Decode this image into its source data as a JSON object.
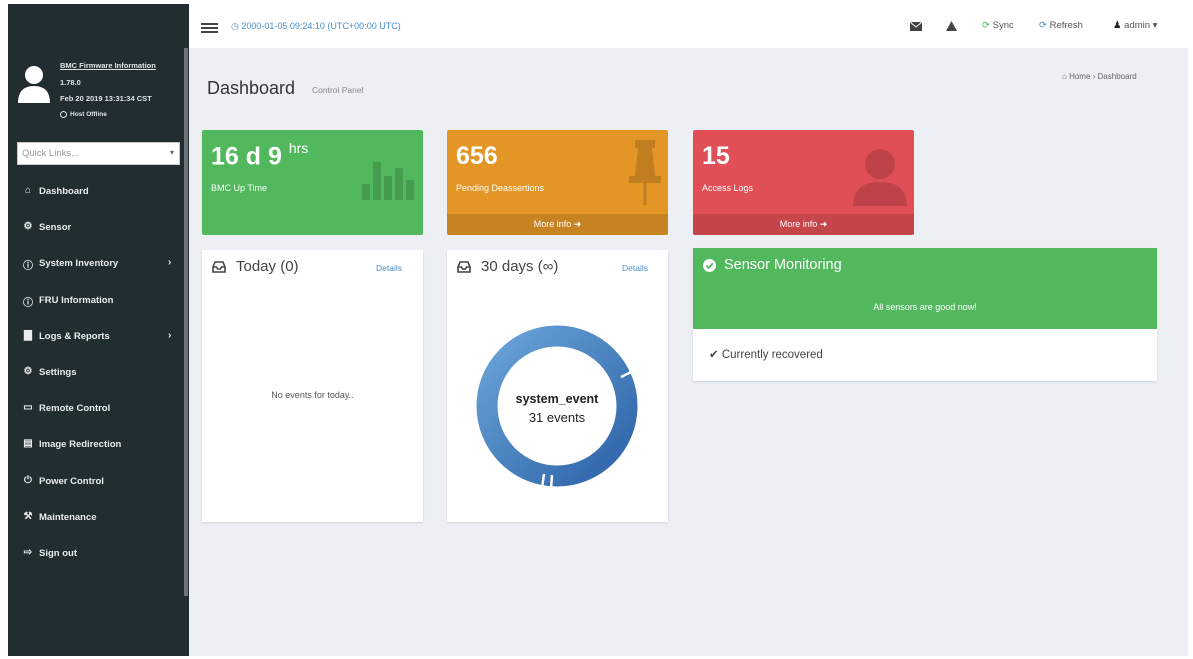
{
  "colors": {
    "sidebar": "#222d32",
    "green": "#51b85d",
    "orange": "#e39526",
    "red": "#e04f55",
    "accent_blue": "#4a8ec5",
    "donut_blue": "#3d77b8"
  },
  "sidebar": {
    "firmware_title": "BMC Firmware Information",
    "firmware_version": "1.78.0",
    "firmware_date": "Feb 20 2019 13:31:34 CST",
    "host_status": "Host Offline",
    "quick_links_placeholder": "Quick Links...",
    "menu": [
      {
        "icon": "home-icon",
        "glyph": "⌂",
        "label": "Dashboard",
        "has_children": false
      },
      {
        "icon": "sensor-icon",
        "glyph": "⚙",
        "label": "Sensor",
        "has_children": false
      },
      {
        "icon": "info-icon",
        "glyph": "ⓘ",
        "label": "System Inventory",
        "has_children": true
      },
      {
        "icon": "info-icon",
        "glyph": "ⓘ",
        "label": "FRU Information",
        "has_children": false
      },
      {
        "icon": "bar-chart-icon",
        "glyph": "▇",
        "label": "Logs & Reports",
        "has_children": true
      },
      {
        "icon": "gear-icon",
        "glyph": "⚙",
        "label": "Settings",
        "has_children": false
      },
      {
        "icon": "monitor-icon",
        "glyph": "▭",
        "label": "Remote Control",
        "has_children": false
      },
      {
        "icon": "disk-icon",
        "glyph": "▤",
        "label": "Image Redirection",
        "has_children": false
      },
      {
        "icon": "power-icon",
        "glyph": "⏻",
        "label": "Power Control",
        "has_children": false
      },
      {
        "icon": "wrench-icon",
        "glyph": "⚒",
        "label": "Maintenance",
        "has_children": false
      },
      {
        "icon": "sign-out-icon",
        "glyph": "⇨",
        "label": "Sign out",
        "has_children": false
      }
    ]
  },
  "header": {
    "datetime": "2000-01-05 09:24:10 (UTC+00:00 UTC)",
    "sync_label": "Sync",
    "refresh_label": "Refresh",
    "user_label": "admin"
  },
  "page": {
    "title": "Dashboard",
    "subtitle": "Control Panel",
    "breadcrumb_home": "Home",
    "breadcrumb_current": "Dashboard"
  },
  "stats": {
    "uptime": {
      "value": "16 d 9",
      "unit": "hrs",
      "label": "BMC Up Time"
    },
    "deassertions": {
      "value": "656",
      "label": "Pending Deassertions",
      "more": "More info"
    },
    "access_logs": {
      "value": "15",
      "label": "Access Logs",
      "more": "More info"
    }
  },
  "today": {
    "title": "Today (0)",
    "details": "Details",
    "empty_message": "No events for today.."
  },
  "thirty_days": {
    "title": "30 days (∞)",
    "details": "Details",
    "donut_label": "system_event",
    "donut_count": "31 events"
  },
  "sensor_monitoring": {
    "title": "Sensor Monitoring",
    "message": "All sensors are good now!",
    "recovered": "Currently recovered"
  }
}
